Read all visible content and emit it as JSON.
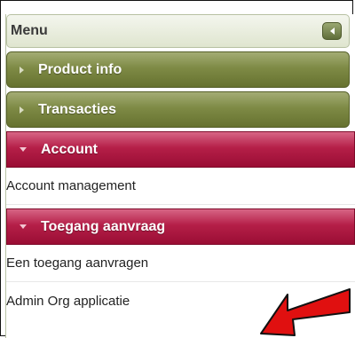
{
  "menu": {
    "title": "Menu",
    "sections": [
      {
        "label": "Product info",
        "state": "collapsed"
      },
      {
        "label": "Transacties",
        "state": "collapsed"
      },
      {
        "label": "Account",
        "state": "expanded",
        "items": [
          "Account management"
        ]
      },
      {
        "label": "Toegang aanvraag",
        "state": "expanded",
        "items": [
          "Een toegang aanvragen",
          "Admin Org applicatie"
        ]
      }
    ]
  },
  "colors": {
    "green_section": "#7e8a45",
    "red_section": "#b51f48",
    "annotation_arrow": "#e01010"
  }
}
